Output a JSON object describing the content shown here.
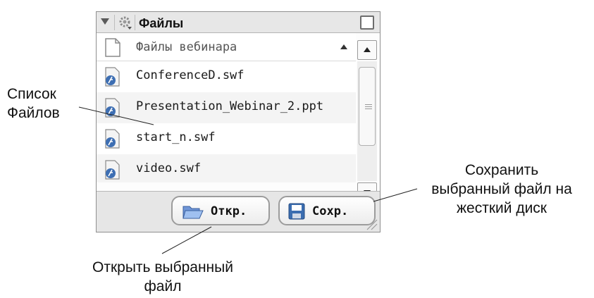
{
  "panel": {
    "title": "Файлы",
    "column_header": "Файлы вебинара",
    "files": [
      {
        "name": "ConferenceD.swf",
        "icon": "flash-file-icon"
      },
      {
        "name": "Presentation_Webinar_2.ppt",
        "icon": "flash-file-icon"
      },
      {
        "name": "start_n.swf",
        "icon": "flash-file-icon"
      },
      {
        "name": "video.swf",
        "icon": "flash-file-icon"
      }
    ],
    "open_button": "Откр.",
    "save_button": "Сохр."
  },
  "annotations": {
    "file_list": [
      "Список",
      "Файлов"
    ],
    "save": [
      "Сохранить",
      "выбранный файл на",
      "жесткий диск"
    ],
    "open": [
      "Открыть выбранный",
      "файл"
    ]
  }
}
